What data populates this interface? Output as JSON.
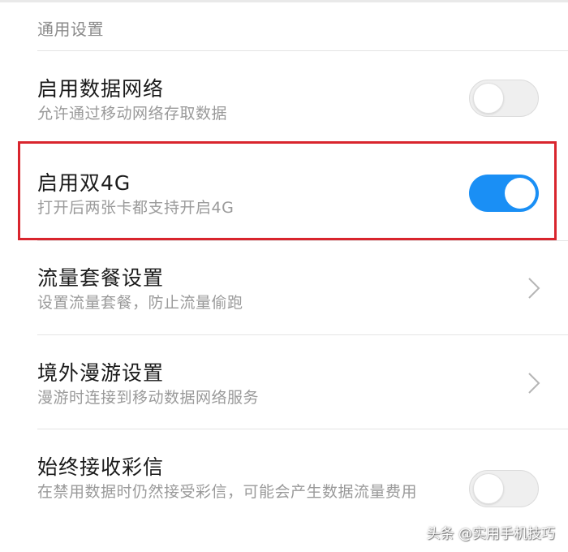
{
  "section": {
    "header": "通用设置"
  },
  "settings": [
    {
      "title": "启用数据网络",
      "subtitle": "允许通过移动网络存取数据",
      "control": "toggle",
      "state": "off"
    },
    {
      "title": "启用双4G",
      "subtitle": "打开后两张卡都支持开启4G",
      "control": "toggle",
      "state": "on"
    },
    {
      "title": "流量套餐设置",
      "subtitle": "设置流量套餐，防止流量偷跑",
      "control": "chevron-right-icon"
    },
    {
      "title": "境外漫游设置",
      "subtitle": "漫游时连接到移动数据网络服务",
      "control": "chevron-right-icon"
    },
    {
      "title": "始终接收彩信",
      "subtitle": "在禁用数据时仍然接受彩信，可能会产生数据流量费用",
      "control": "toggle",
      "state": "off"
    }
  ],
  "watermark": "头条 @实用手机技巧",
  "colors": {
    "toggle_on": "#1a8ff5",
    "highlight": "#d9252d"
  }
}
